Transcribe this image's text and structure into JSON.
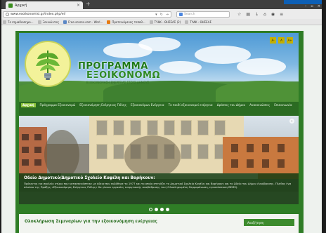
{
  "browser": {
    "tab_title": "Αρχική",
    "url": "www.exoikonomisi.gr/index.php/el/",
    "search_placeholder": "Search",
    "bookmarks": [
      {
        "label": "Το σημαδιοσημο...",
        "icon": "bookmark-icon"
      },
      {
        "label": "Ξεκινώντας",
        "icon": "bookmark-icon"
      },
      {
        "label": "Free-scores.com · Worl...",
        "icon": "bookmark-icon"
      },
      {
        "label": "Προτεινόμενες τοποθ...",
        "icon": "bookmark-icon-orange"
      },
      {
        "label": "ΤΥΔΚ - ΘΗΣΕΑΣ (2)",
        "icon": "bookmark-icon"
      },
      {
        "label": "ΤΥΔΚ - ΘΗΣΕΑΣ",
        "icon": "bookmark-icon"
      }
    ]
  },
  "site": {
    "logo_title_line1": "ΠΡΟΓΡΑΜΜΑ",
    "logo_title_line2": "ΕΞΟΙΚΟΝΟΜΩ",
    "logo_tagline": "ΕΞΟΙΚΟΝΟΜΗΣΗ ΕΝΕΡΓΕΙΑΣ ΣΤΟΥΣ ΔΗΜΟΥΣ",
    "font_buttons": [
      "A-",
      "A",
      "A+"
    ],
    "menu": [
      {
        "label": "Αρχική",
        "active": true
      },
      {
        "label": "Πρόγραμμα Εξοικονομώ",
        "active": false
      },
      {
        "label": "Εξοικονόμηση Ενέργειας Πόλης",
        "active": false
      },
      {
        "label": "Εξοικονόμων Ενέργεια",
        "active": false
      },
      {
        "label": "Το παιδί εξοικονομεί ενέργεια",
        "active": false
      },
      {
        "label": "Δράσεις του Δήμου",
        "active": false
      },
      {
        "label": "Ανακοινώσεις",
        "active": false
      },
      {
        "label": "Επικοινωνία",
        "active": false
      }
    ],
    "slider": {
      "caption_title": "Οδείο Δημοτικό/Δημοτικό Σχολείο Κυψέλη και Βορήκουν:",
      "caption_text": "Πρόκειται για σχολείο κτίριο που κατασκευάστηκε με άδεια που εκδόθηκε το 1977 και το οποίο στεγάζει το Δημοτικό Σχολείο Κυψέλη και Βορήκουν και το Ωδείο του Δήμου Λυκόβρυσης. Πλήθος ένα πλαίσιο της Πράξης «Εξοικονόμηση Ενέργειας Πόλης» θα γίνουν εργασίες ενεργειακής αναβάθμισης του (Ολοκληρωμένη Θερμομόνωση, εγκατάσταση ΒΕΜS).",
      "dots": 4,
      "active_dot": 0
    },
    "content_title": "Ολοκλήρωση Σεμιναρίων για την εξοικονόμηση ενέργειας",
    "search_label": "Αναζήτηση"
  }
}
